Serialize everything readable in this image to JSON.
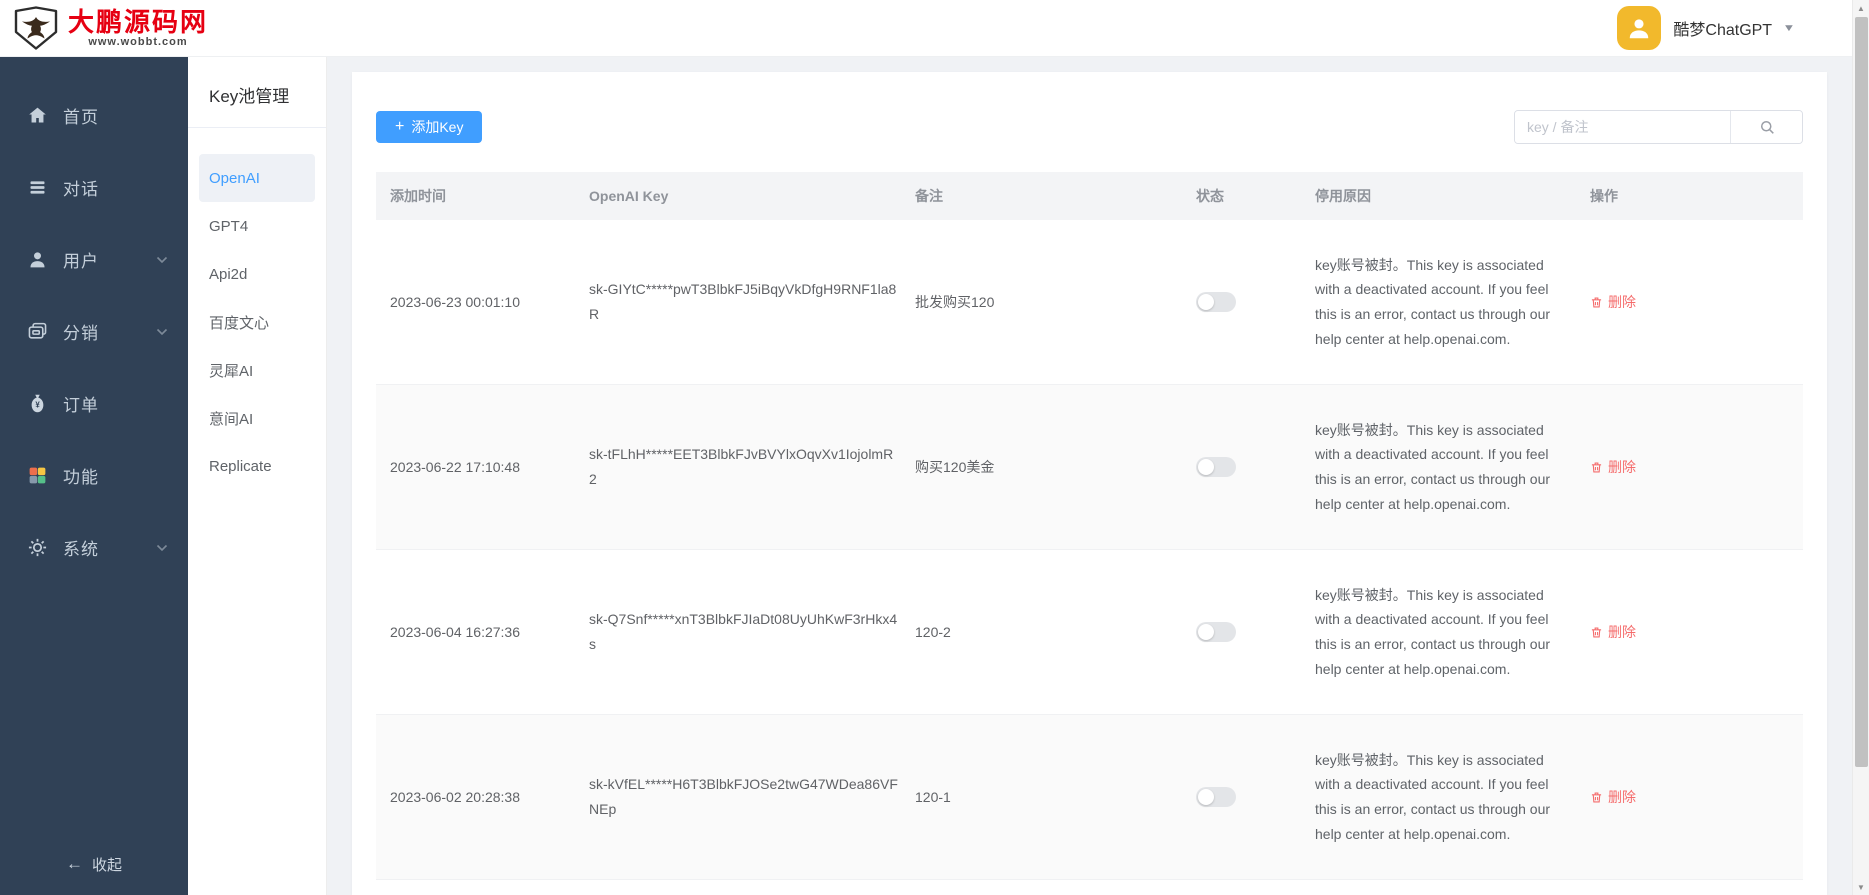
{
  "topbar": {
    "brand": {
      "name": "大鹏源码网",
      "url": "www.wobbt.com"
    },
    "user": {
      "name": "酷梦ChatGPT"
    }
  },
  "sidebar": {
    "items": [
      {
        "label": "首页",
        "icon": "home-icon",
        "has_submenu": false
      },
      {
        "label": "对话",
        "icon": "chat-list-icon",
        "has_submenu": false
      },
      {
        "label": "用户",
        "icon": "user-icon",
        "has_submenu": true
      },
      {
        "label": "分销",
        "icon": "distribution-icon",
        "has_submenu": true
      },
      {
        "label": "订单",
        "icon": "money-bag-icon",
        "has_submenu": false
      },
      {
        "label": "功能",
        "icon": "features-grid-icon",
        "has_submenu": false
      },
      {
        "label": "系统",
        "icon": "gear-icon",
        "has_submenu": true
      }
    ],
    "collapse": {
      "label": "收起",
      "arrow": "←"
    }
  },
  "submenu": {
    "title": "Key池管理",
    "items": [
      {
        "label": "OpenAI",
        "active": true
      },
      {
        "label": "GPT4",
        "active": false
      },
      {
        "label": "Api2d",
        "active": false
      },
      {
        "label": "百度文心",
        "active": false
      },
      {
        "label": "灵犀AI",
        "active": false
      },
      {
        "label": "意间AI",
        "active": false
      },
      {
        "label": "Replicate",
        "active": false
      }
    ]
  },
  "toolbar": {
    "add_key_label": "添加Key",
    "add_icon": "+",
    "search_placeholder": "key / 备注"
  },
  "table": {
    "headers": [
      "添加时间",
      "OpenAI Key",
      "备注",
      "状态",
      "停用原因",
      "操作"
    ],
    "delete_label": "删除",
    "rows": [
      {
        "added_at": "2023-06-23 00:01:10",
        "key": "sk-GIYtC*****pwT3BlbkFJ5iBqyVkDfgH9RNF1la8R",
        "note": "批发购买120",
        "status_on": false,
        "reason": "key账号被封。This key is associated with a deactivated account. If you feel this is an error, contact us through our help center at help.openai.com."
      },
      {
        "added_at": "2023-06-22 17:10:48",
        "key": "sk-tFLhH*****EET3BlbkFJvBVYlxOqvXv1IojolmR2",
        "note": "购买120美金",
        "status_on": false,
        "reason": "key账号被封。This key is associated with a deactivated account. If you feel this is an error, contact us through our help center at help.openai.com."
      },
      {
        "added_at": "2023-06-04 16:27:36",
        "key": "sk-Q7Snf*****xnT3BlbkFJIaDt08UyUhKwF3rHkx4s",
        "note": "120-2",
        "status_on": false,
        "reason": "key账号被封。This key is associated with a deactivated account. If you feel this is an error, contact us through our help center at help.openai.com."
      },
      {
        "added_at": "2023-06-02 20:28:38",
        "key": "sk-kVfEL*****H6T3BlbkFJOSe2twG47WDea86VFNEp",
        "note": "120-1",
        "status_on": false,
        "reason": "key账号被封。This key is associated with a deactivated account. If you feel this is an error, contact us through our help center at help.openai.com."
      }
    ]
  },
  "icons": {
    "caret_down": "▼",
    "scroll_up": "▲",
    "scroll_down": "▼"
  },
  "colors": {
    "primary_blue": "#409eff",
    "brand_red": "#e60012",
    "avatar_yellow": "#f2b92c",
    "danger_red": "#f56c6c",
    "sidebar_dark": "#304156",
    "active_submenu_bg": "#eef1f6"
  }
}
